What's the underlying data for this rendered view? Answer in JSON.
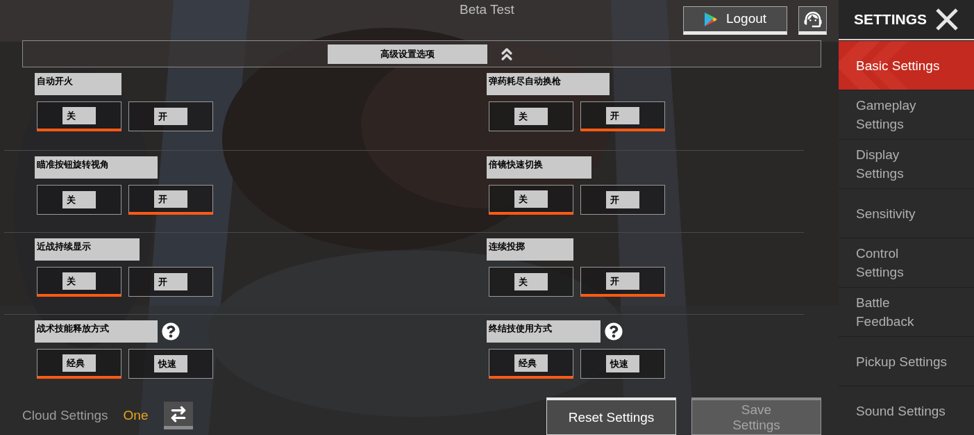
{
  "top_bar": {
    "title": "Beta Test",
    "logout_button": "Logout"
  },
  "section": {
    "title": "高级设置选项",
    "expanded": true
  },
  "settings": [
    {
      "label": "自动开火",
      "help": false,
      "options": [
        {
          "label": "关",
          "selected": true
        },
        {
          "label": "开",
          "selected": false
        }
      ]
    },
    {
      "label": "弹药耗尽自动换枪",
      "help": false,
      "options": [
        {
          "label": "关",
          "selected": false
        },
        {
          "label": "开",
          "selected": true
        }
      ]
    },
    {
      "label": "瞄准按钮旋转视角",
      "help": false,
      "options": [
        {
          "label": "关",
          "selected": false
        },
        {
          "label": "开",
          "selected": true
        }
      ]
    },
    {
      "label": "倍镜快速切换",
      "help": false,
      "options": [
        {
          "label": "关",
          "selected": true
        },
        {
          "label": "开",
          "selected": false
        }
      ]
    },
    {
      "label": "近战持续显示",
      "help": false,
      "options": [
        {
          "label": "关",
          "selected": true
        },
        {
          "label": "开",
          "selected": false
        }
      ]
    },
    {
      "label": "连续投掷",
      "help": false,
      "options": [
        {
          "label": "关",
          "selected": false
        },
        {
          "label": "开",
          "selected": true
        }
      ]
    },
    {
      "label": "战术技能释放方式",
      "help": true,
      "options": [
        {
          "label": "经典",
          "selected": true
        },
        {
          "label": "快速",
          "selected": false
        }
      ]
    },
    {
      "label": "终结技使用方式",
      "help": true,
      "options": [
        {
          "label": "经典",
          "selected": true
        },
        {
          "label": "快速",
          "selected": false
        }
      ]
    }
  ],
  "cloud_settings": {
    "label": "Cloud Settings",
    "value": "One"
  },
  "buttons": [
    {
      "label": "Reset Settings",
      "disabled": false
    },
    {
      "label": "Save\nSettings",
      "disabled": true
    }
  ],
  "sidebar": {
    "title": "SETTINGS",
    "items": [
      {
        "label": "Basic Settings",
        "selected": true
      },
      {
        "label": "Gameplay\nSettings",
        "selected": false
      },
      {
        "label": "Display\nSettings",
        "selected": false
      },
      {
        "label": "Sensitivity",
        "selected": false
      },
      {
        "label": "Control\nSettings",
        "selected": false
      },
      {
        "label": "Battle\nFeedback",
        "selected": false
      },
      {
        "label": "Pickup Settings",
        "selected": false
      },
      {
        "label": "Sound Settings",
        "selected": false
      }
    ]
  }
}
